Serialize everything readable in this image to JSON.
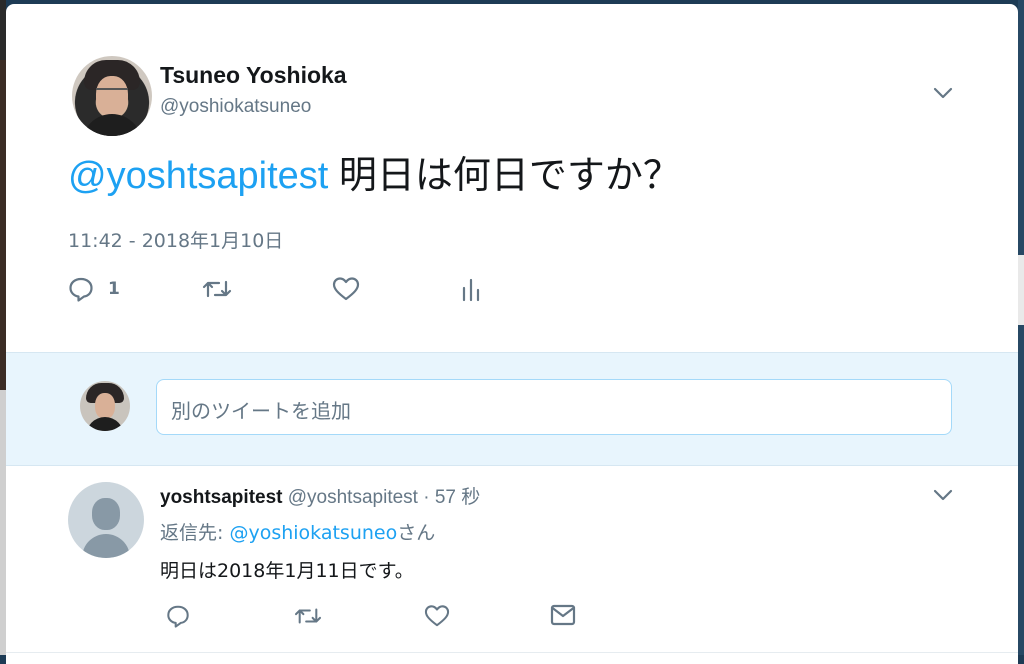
{
  "tweet": {
    "display_name": "Tsuneo Yoshioka",
    "handle": "@yoshiokatsuneo",
    "mention": "@yoshtsapitest",
    "text": " 明日は何日ですか？",
    "timestamp": "11:42 - 2018年1月10日",
    "reply_count": "1",
    "icons": [
      "reply-icon",
      "retweet-icon",
      "like-icon",
      "analytics-icon",
      "chevron-down-icon"
    ]
  },
  "compose": {
    "placeholder": "別のツイートを追加"
  },
  "reply": {
    "name": "yoshtsapitest",
    "handle": "@yoshtsapitest",
    "time": "· 57 秒",
    "reply_to_label": "返信先: ",
    "reply_to_mention": "@yoshiokatsuneo",
    "reply_to_suffix": "さん",
    "text": "明日は2018年1月11日です。",
    "icons": [
      "reply-icon",
      "retweet-icon",
      "like-icon",
      "message-icon",
      "chevron-down-icon"
    ]
  },
  "colors": {
    "accent": "#1da1f2",
    "secondary_text": "#657786",
    "compose_bg": "#e8f5fd"
  }
}
